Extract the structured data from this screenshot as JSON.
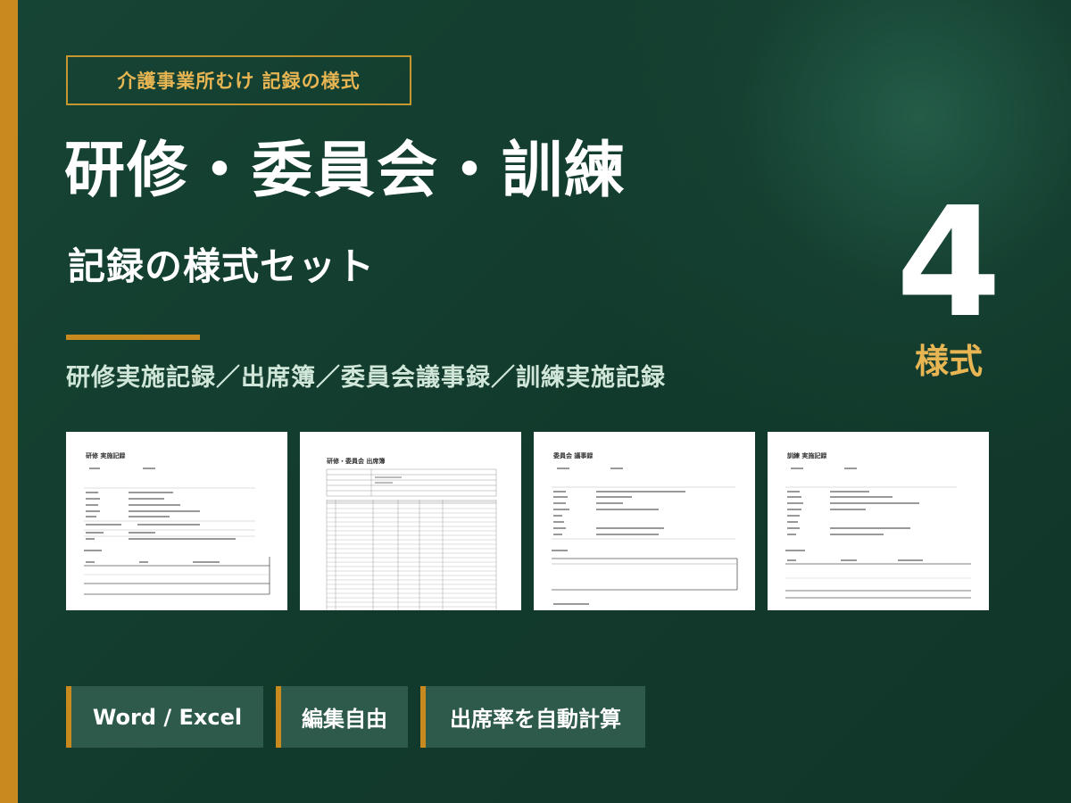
{
  "header": {
    "badge": "介護事業所むけ 記録の様式",
    "title": "研修・委員会・訓練",
    "subtitle": "記録の様式セット",
    "doc_list": "研修実施記録／出席簿／委員会議事録／訓練実施記録"
  },
  "count": {
    "number": "4",
    "label": "様式"
  },
  "thumbnails": [
    {
      "title": "研修 実施記録"
    },
    {
      "title": "研修・委員会 出席簿"
    },
    {
      "title": "委員会 議事録"
    },
    {
      "title": "訓練 実施記録"
    }
  ],
  "tags": [
    "Word / Excel",
    "編集自由",
    "出席率を自動計算"
  ],
  "colors": {
    "background": "#123a2c",
    "accent": "#c8891f",
    "badge_text": "#e8b553",
    "doc_list_text": "#cfe6d8",
    "tag_bg": "#2d5a4b"
  }
}
